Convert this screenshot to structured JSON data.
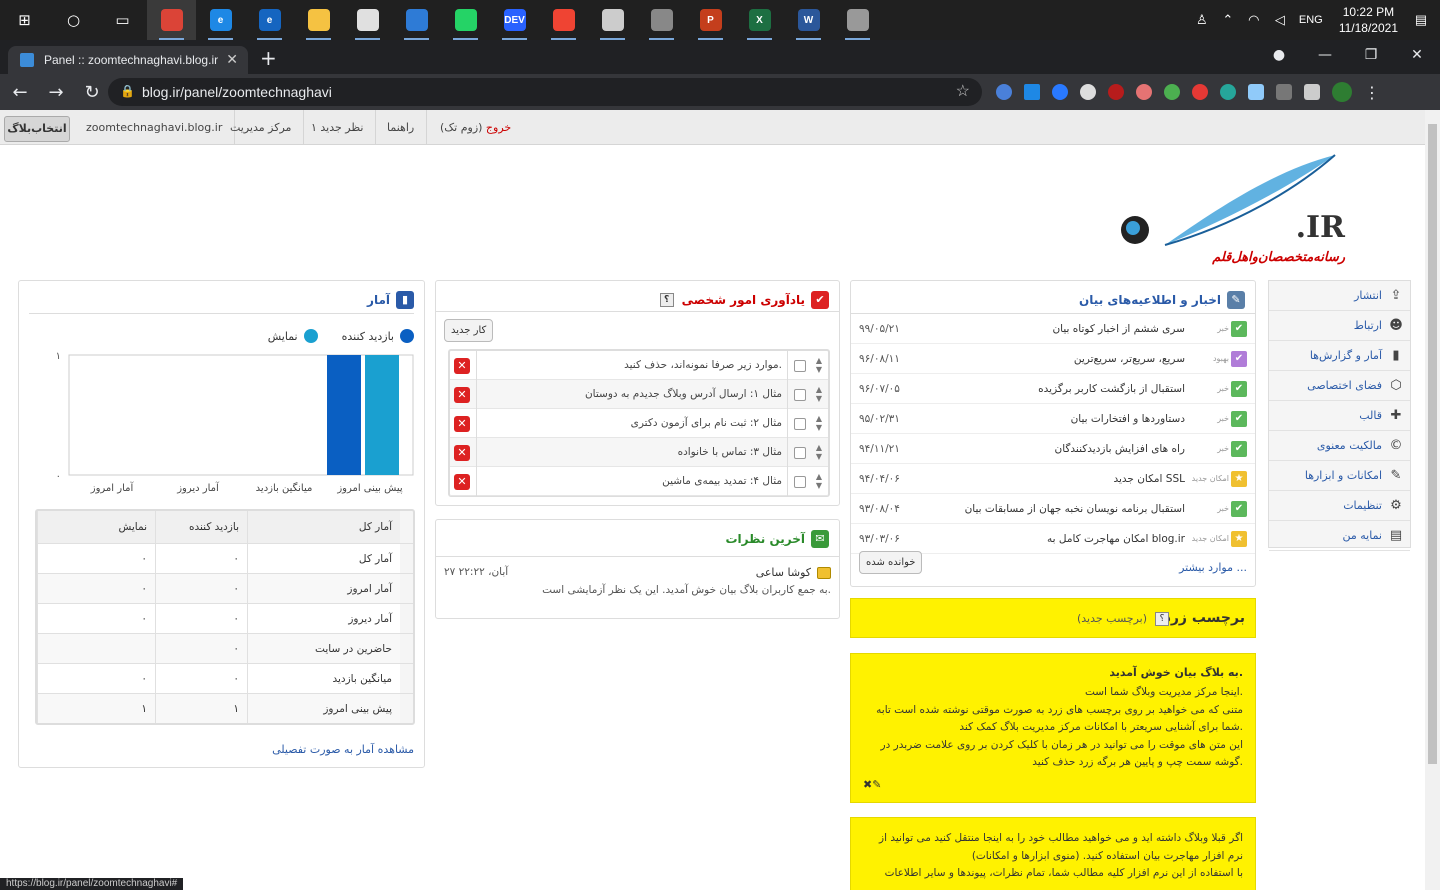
{
  "taskbar": {
    "apps": [
      {
        "name": "chrome",
        "color": "#db4437",
        "label": "",
        "active": true
      },
      {
        "name": "edge",
        "color": "#1e88e5",
        "label": "e"
      },
      {
        "name": "ie",
        "color": "#1565c0",
        "label": "e"
      },
      {
        "name": "explorer",
        "color": "#f5c242",
        "label": ""
      },
      {
        "name": "store",
        "color": "#e0e0e0",
        "label": ""
      },
      {
        "name": "mail",
        "color": "#2e7bd6",
        "label": ""
      },
      {
        "name": "whatsapp",
        "color": "#25d366",
        "label": ""
      },
      {
        "name": "dev",
        "color": "#2962ff",
        "label": "DEV"
      },
      {
        "name": "anydesk",
        "color": "#ef4433",
        "label": ""
      },
      {
        "name": "app-a",
        "color": "#cccccc",
        "label": ""
      },
      {
        "name": "app-b",
        "color": "#888888",
        "label": ""
      },
      {
        "name": "powerpoint",
        "color": "#c43e1c",
        "label": "P"
      },
      {
        "name": "excel",
        "color": "#1d6f42",
        "label": "X"
      },
      {
        "name": "word",
        "color": "#2b579a",
        "label": "W"
      },
      {
        "name": "app-c",
        "color": "#999999",
        "label": ""
      }
    ],
    "lang": "ENG",
    "time": "10:22 PM",
    "date": "11/18/2021"
  },
  "browser": {
    "tab_title": "Panel :: zoomtechnaghavi.blog.ir",
    "url": "blog.ir/panel/zoomtechnaghavi",
    "status_url": "https://blog.ir/panel/zoomtechnaghavi#"
  },
  "topmenu": {
    "select_blog": "انتخاب‌بلاگ",
    "blog_domain": "zoomtechnaghavi.blog.ir",
    "admin_center": "مرکز مدیریت",
    "new_comment": "۱ نظر جدید",
    "help": "راهنما",
    "logout": "خروج",
    "zoomtech": "(زوم تک)"
  },
  "logo": {
    "ir": ".IR",
    "tagline": "رسانه‌متخصصان‌و‌اهل‌قلم"
  },
  "sidebar": {
    "items": [
      {
        "label": "انتشار",
        "icon": "publish-icon"
      },
      {
        "label": "ارتباط",
        "icon": "contact-icon"
      },
      {
        "label": "آمار و گزارش‌ها",
        "icon": "stats-icon"
      },
      {
        "label": "فضای اختصاصی",
        "icon": "space-icon"
      },
      {
        "label": "قالب",
        "icon": "template-icon"
      },
      {
        "label": "مالکیت معنوی",
        "icon": "copyright-icon"
      },
      {
        "label": "امکانات و ابزارها",
        "icon": "tools-icon"
      },
      {
        "label": "تنظیمات",
        "icon": "settings-icon"
      },
      {
        "label": "نمایه من",
        "icon": "profile-icon"
      }
    ]
  },
  "news": {
    "title": "اخبار و اطلاعیه‌های بیان",
    "items": [
      {
        "title": "سری ششم از اخبار کوتاه بیان",
        "kind": "خبر",
        "date": "۹۹/۰۵/۲۱",
        "color": "#5cb85c"
      },
      {
        "title": "سریع، سریع‌تر، سریع‌ترین",
        "kind": "بهبود",
        "date": "۹۶/۰۸/۱۱",
        "color": "#b07cd8"
      },
      {
        "title": "استقبال از بازگشت کاربر برگزیده",
        "kind": "خبر",
        "date": "۹۶/۰۷/۰۵",
        "color": "#5cb85c"
      },
      {
        "title": "دستاوردها و افتخارات بیان",
        "kind": "خبر",
        "date": "۹۵/۰۲/۳۱",
        "color": "#5cb85c"
      },
      {
        "title": "راه های افزایش بازدیدکنندگان",
        "kind": "خبر",
        "date": "۹۴/۱۱/۲۱",
        "color": "#5cb85c"
      },
      {
        "title": "امکان جدید SSL",
        "kind": "امکان جدید",
        "date": "۹۴/۰۴/۰۶",
        "color": "#f0c030"
      },
      {
        "title": "استقبال برنامه نویسان نخبه جهان از مسابقات بیان",
        "kind": "خبر",
        "date": "۹۳/۰۸/۰۴",
        "color": "#5cb85c"
      },
      {
        "title": "امکان مهاجرت کامل به blog.ir",
        "kind": "امکان جدید",
        "date": "۹۳/۰۳/۰۶",
        "color": "#f0c030"
      }
    ],
    "read_btn": "خوانده شده",
    "more": "موارد بیشتر ..."
  },
  "todo": {
    "title": "یادآوری امور شخصی",
    "help": "؟",
    "new_btn": "کار جدید",
    "items": [
      "موارد زیر صرفا نمونه‌اند، حذف کنید.",
      "مثال ۱: ارسال آدرس وبلاگ جدیدم به دوستان",
      "مثال ۲: ثبت نام برای آزمون دکتری",
      "مثال ۳: تماس با خانواده",
      "مثال ۴: تمدید بیمه‌ی ماشین"
    ]
  },
  "comments": {
    "title": "آخرین نظرات",
    "author": "کوشا ساعی",
    "date": "۲۷ آبان، ۲۲:۲۲",
    "text": "به جمع کاربران بلاگ بیان خوش آمدید. این یک نظر آزمایشی است."
  },
  "stats": {
    "title": "آمار",
    "legend_visitor": "بازدید کننده",
    "legend_view": "نمایش",
    "y_top": "۱",
    "y_bottom": "۰",
    "x_labels": [
      "پیش بینی امروز",
      "میانگین بازدید",
      "آمار دیروز",
      "آمار امروز"
    ],
    "headers": [
      "آمار کل",
      "بازدید کننده",
      "نمایش"
    ],
    "rows": [
      [
        "آمار کل",
        "۰",
        "۰"
      ],
      [
        "آمار امروز",
        "۰",
        "۰"
      ],
      [
        "آمار دیروز",
        "۰",
        "۰"
      ],
      [
        "حاضرین در سایت",
        "۰",
        ""
      ],
      [
        "میانگین بازدید",
        "۰",
        "۰"
      ],
      [
        "پیش بینی امروز",
        "۱",
        "۱"
      ]
    ],
    "detail_link": "مشاهده آمار به صورت تفصیلی"
  },
  "chart_data": {
    "type": "bar",
    "categories": [
      "پیش بینی امروز",
      "میانگین بازدید",
      "آمار دیروز",
      "آمار امروز"
    ],
    "series": [
      {
        "name": "بازدید کننده",
        "values": [
          1,
          0,
          0,
          0
        ],
        "color": "#0a5fc2"
      },
      {
        "name": "نمایش",
        "values": [
          1,
          0,
          0,
          0
        ],
        "color": "#1aa0d0"
      }
    ],
    "ylim": [
      0,
      1
    ]
  },
  "yellow": {
    "title": "برچسب زرد",
    "tag": "(برچسب جدید)",
    "help": "؟",
    "note_title": "به بلاگ بیان خوش آمدید.",
    "note_lines": [
      "اینجا مرکز مدیریت وبلاگ شما است.",
      "متنی که می خواهید بر روی برچسب های زرد به صورت موقتی نوشته شده است تابه",
      "شما برای آشنایی سریعتر با امکانات مرکز مدیریت بلاگ کمک کند.",
      "این متن های موقت را می توانید در هر زمان با کلیک کردن بر روی علامت ضربدر در",
      "گوشه سمت چپ و پایین هر برگه زرد حذف کنید."
    ],
    "note2_lines": [
      "اگر قبلا وبلاگ داشته اید و می خواهید مطالب خود را به اینجا منتقل کنید می توانید از",
      "نرم افزار مهاجرت بیان استفاده کنید. (منوی ابزارها و امکانات)",
      "با استفاده از این نرم افزار کلیه مطالب شما، تمام نظرات، پیوندها و سایر اطلاعات"
    ]
  }
}
